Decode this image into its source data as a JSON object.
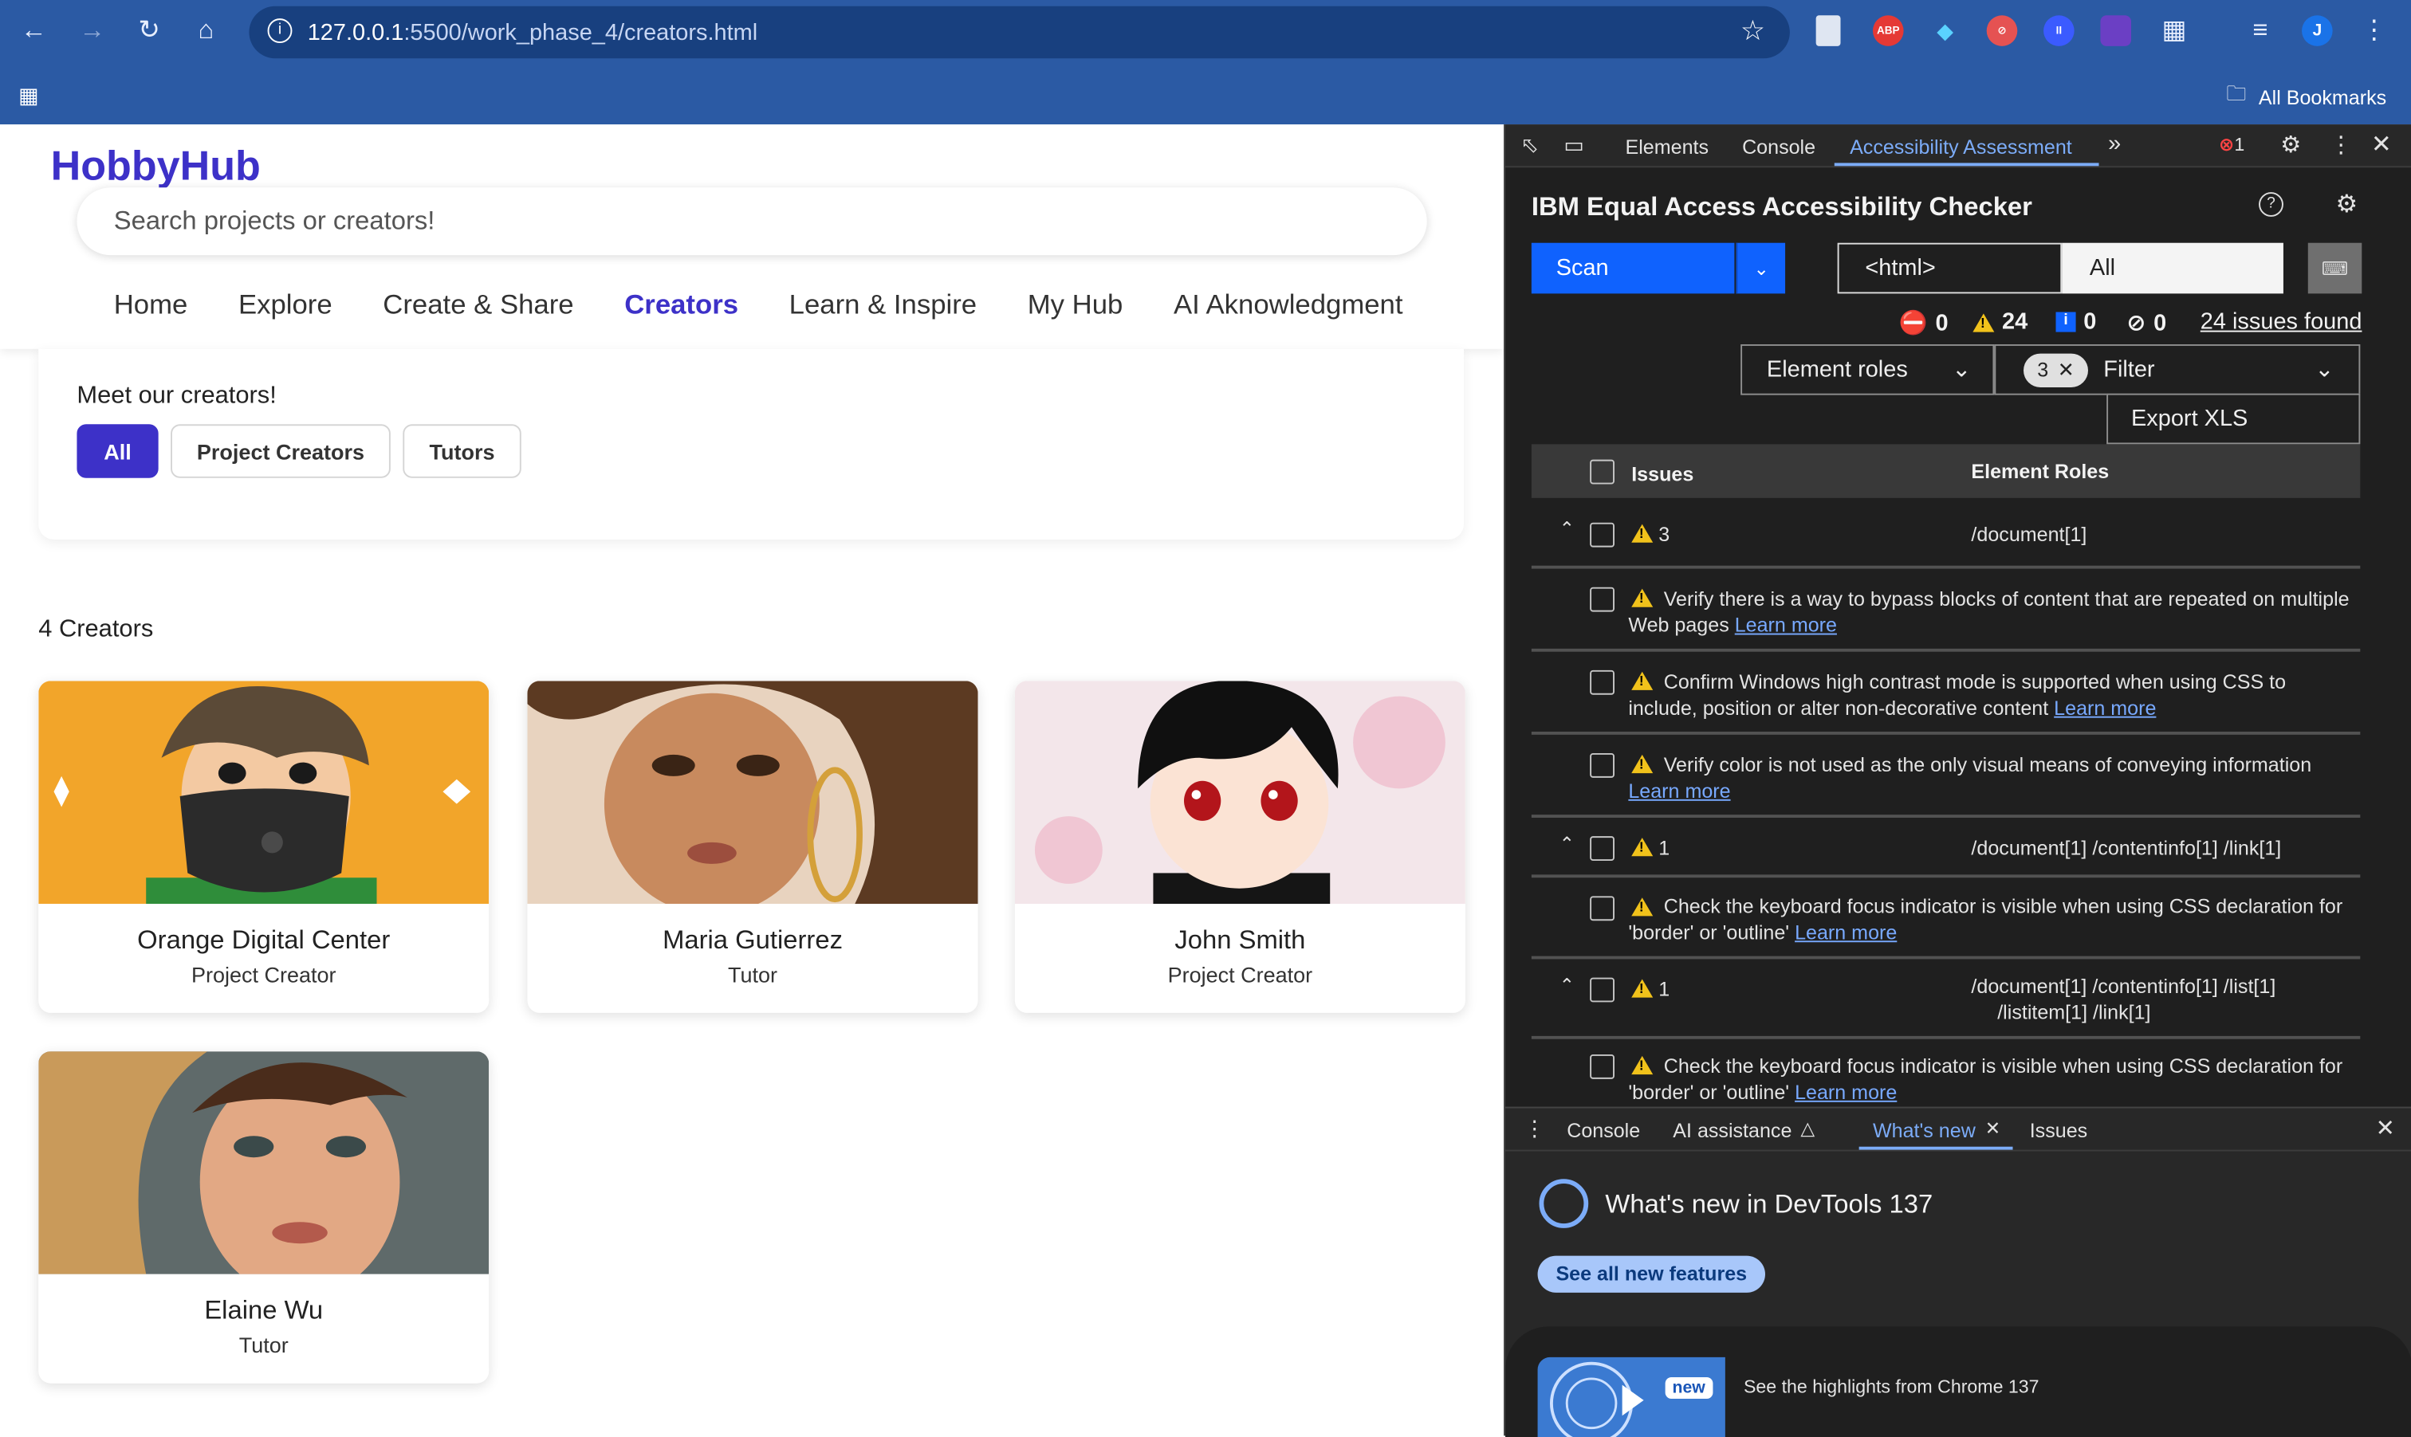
{
  "browser": {
    "url_host": "127.0.0.1",
    "url_path": ":5500/work_phase_4/creators.html",
    "bookmarks_label": "All Bookmarks",
    "profile_initial": "J",
    "ext_abp": "ABP"
  },
  "site": {
    "logo": "HobbyHub",
    "search_placeholder": "Search projects or creators!",
    "nav": [
      "Home",
      "Explore",
      "Create & Share",
      "Creators",
      "Learn & Inspire",
      "My Hub",
      "AI Aknowledgment"
    ],
    "meet_heading": "Meet our creators!",
    "filters": [
      "All",
      "Project Creators",
      "Tutors"
    ],
    "count_label": "4 Creators",
    "creators": [
      {
        "name": "Orange Digital Center",
        "role": "Project Creator"
      },
      {
        "name": "Maria Gutierrez",
        "role": "Tutor"
      },
      {
        "name": "John Smith",
        "role": "Project Creator"
      },
      {
        "name": "Elaine Wu",
        "role": "Tutor"
      }
    ]
  },
  "devtools": {
    "tabs": [
      "Elements",
      "Console",
      "Accessibility Assessment"
    ],
    "error_count": "1",
    "checker_title": "IBM Equal Access Accessibility Checker",
    "scan_label": "Scan",
    "scope_value": "<html>",
    "rules_value": "All",
    "counts": {
      "violations": "0",
      "needs_review": "24",
      "recommendations": "0",
      "hidden": "0"
    },
    "issues_found": "24 issues found",
    "element_roles_label": "Element roles",
    "filter_badge": "3",
    "filter_label": "Filter",
    "export_label": "Export XLS",
    "col_issues": "Issues",
    "col_roles": "Element Roles",
    "learn_more": "Learn more",
    "groups": [
      {
        "count": "3",
        "path": "/document[1]"
      },
      {
        "count": "1",
        "path": "/document[1] /contentinfo[1] /link[1]"
      },
      {
        "count": "1",
        "path": "/document[1] /contentinfo[1] /list[1]",
        "path2": "/listitem[1] /link[1]"
      }
    ],
    "issues": [
      "Verify there is a way to bypass blocks of content that are repeated on multiple Web pages",
      "Confirm Windows high contrast mode is supported when using CSS to include, position or alter non-decorative content",
      "Verify color is not used as the only visual means of conveying information",
      "Check the keyboard focus indicator is visible when using CSS declaration for 'border' or 'outline'",
      "Check the keyboard focus indicator is visible when using CSS declaration for 'border' or 'outline'"
    ],
    "drawer_tabs": [
      "Console",
      "AI assistance",
      "What's new",
      "Issues"
    ],
    "whats_new_title": "What's new in DevTools 137",
    "see_all": "See all new features",
    "new_badge": "new",
    "highlights": "See the highlights from Chrome 137"
  }
}
